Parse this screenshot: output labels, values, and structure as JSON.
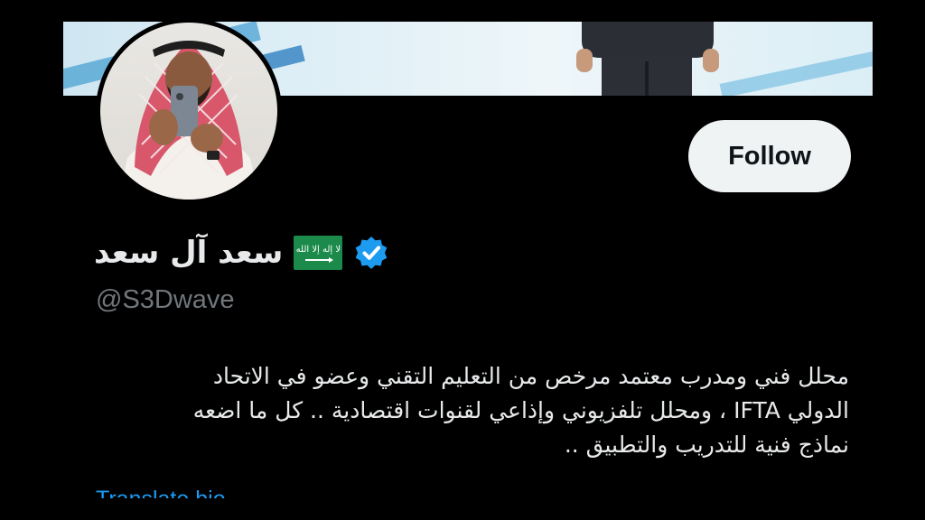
{
  "profile": {
    "display_name": "سعد آل سعد",
    "flag_script": "لا إله إلا الله",
    "handle": "@S3Dwave",
    "follow_label": "Follow",
    "bio_lines": [
      "محلل فني ومدرب معتمد مرخص من التعليم التقني وعضو في الاتحاد",
      "الدولي IFTA ، ومحلل تلفزيوني وإذاعي لقنوات اقتصادية .. كل ما اضعه",
      "نماذج فنية للتدريب والتطبيق .."
    ],
    "translate_label": "Translate bio"
  },
  "icons": {
    "flag": "saudi-flag-icon",
    "verified": "verified-badge-icon"
  },
  "colors": {
    "background": "#000000",
    "text_primary": "#e7e9ea",
    "text_secondary": "#71767b",
    "link": "#1d9bf0",
    "follow_bg": "#eff3f4",
    "verified": "#1d9bf0",
    "flag_green": "#1b8a4a"
  }
}
